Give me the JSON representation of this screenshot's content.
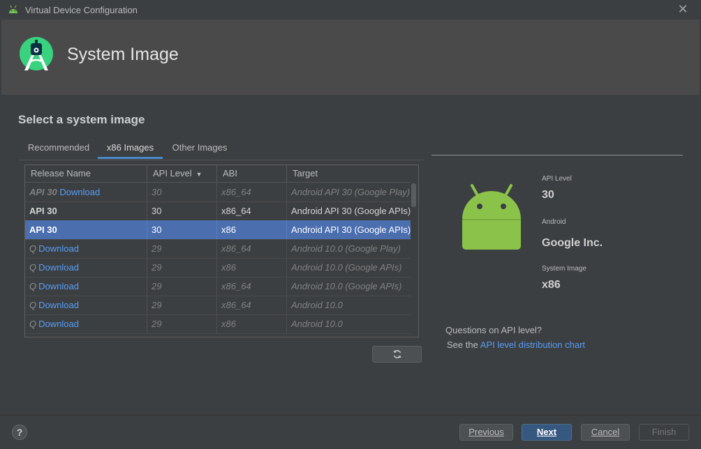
{
  "window": {
    "title": "Virtual Device Configuration",
    "close_icon": "close-icon"
  },
  "header": {
    "title": "System Image",
    "logo": "android-studio-logo"
  },
  "main": {
    "subtitle": "Select a system image",
    "tabs": [
      {
        "label": "Recommended",
        "active": false
      },
      {
        "label": "x86 Images",
        "active": true
      },
      {
        "label": "Other Images",
        "active": false
      }
    ],
    "table": {
      "columns": [
        "Release Name",
        "API Level",
        "ABI",
        "Target"
      ],
      "sort_column": "API Level",
      "rows": [
        {
          "release": "API 30",
          "link": "Download",
          "api": "30",
          "abi": "x86_64",
          "target": "Android API 30 (Google Play)",
          "style": "dim"
        },
        {
          "release": "API 30",
          "link": "",
          "api": "30",
          "abi": "x86_64",
          "target": "Android API 30 (Google APIs)",
          "style": "normal"
        },
        {
          "release": "API 30",
          "link": "",
          "api": "30",
          "abi": "x86",
          "target": "Android API 30 (Google APIs)",
          "style": "selected"
        },
        {
          "release": "Q",
          "link": "Download",
          "api": "29",
          "abi": "x86_64",
          "target": "Android 10.0 (Google Play)",
          "style": "dim"
        },
        {
          "release": "Q",
          "link": "Download",
          "api": "29",
          "abi": "x86",
          "target": "Android 10.0 (Google APIs)",
          "style": "dim"
        },
        {
          "release": "Q",
          "link": "Download",
          "api": "29",
          "abi": "x86_64",
          "target": "Android 10.0 (Google APIs)",
          "style": "dim"
        },
        {
          "release": "Q",
          "link": "Download",
          "api": "29",
          "abi": "x86_64",
          "target": "Android 10.0",
          "style": "dim"
        },
        {
          "release": "Q",
          "link": "Download",
          "api": "29",
          "abi": "x86",
          "target": "Android 10.0",
          "style": "dim"
        }
      ]
    },
    "refresh_icon": "refresh-icon"
  },
  "details": {
    "api_level_label": "API Level",
    "api_level_value": "30",
    "android_label": "Android",
    "android_value": "Google Inc.",
    "system_image_label": "System Image",
    "system_image_value": "x86",
    "questions": "Questions on API level?",
    "see_the": "See the",
    "chart_link": "API level distribution chart"
  },
  "footer": {
    "help": "?",
    "previous_label": "Previous",
    "next_label": "Next",
    "cancel_label": "Cancel",
    "finish_label": "Finish"
  },
  "colors": {
    "background": "#3c3f41",
    "header": "#4a4a4a",
    "selection": "#4b6eaf",
    "link": "#589df6",
    "android_green": "#8bc34a"
  }
}
